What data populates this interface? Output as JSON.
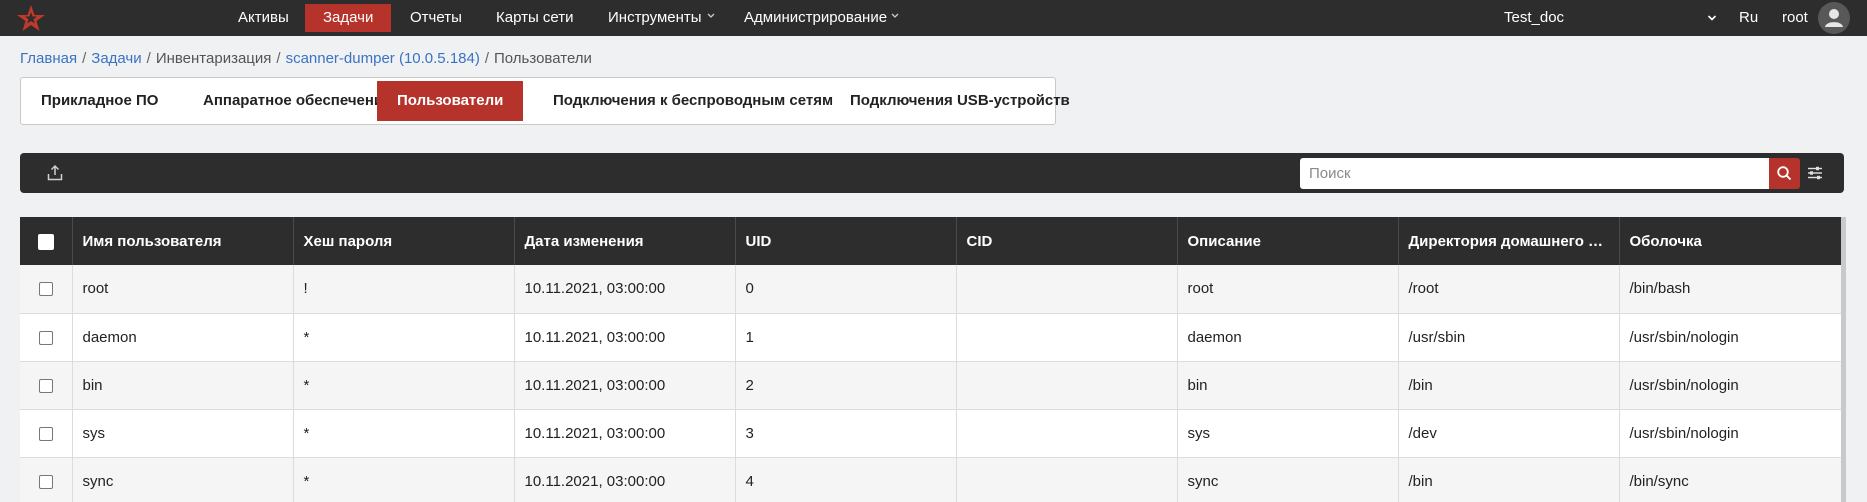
{
  "topbar": {
    "nav": [
      {
        "label": "Активы"
      },
      {
        "label": "Задачи",
        "active": true
      },
      {
        "label": "Отчеты"
      },
      {
        "label": "Карты сети"
      },
      {
        "label": "Инструменты",
        "dropdown": true
      },
      {
        "label": "Администрирование",
        "dropdown": true
      }
    ],
    "workspace": "Test_doc",
    "language": "Ru",
    "user": "root"
  },
  "breadcrumb": [
    {
      "label": "Главная",
      "link": true
    },
    {
      "label": "Задачи",
      "link": true
    },
    {
      "label": "Инвентаризация",
      "link": false
    },
    {
      "label": "scanner-dumper (10.0.5.184)",
      "link": true
    },
    {
      "label": "Пользователи",
      "link": false
    }
  ],
  "tabs": [
    {
      "label": "Прикладное ПО"
    },
    {
      "label": "Аппаратное обеспечение"
    },
    {
      "label": "Пользователи",
      "active": true
    },
    {
      "label": "Подключения к беспроводным сетям"
    },
    {
      "label": "Подключения USB-устройств"
    }
  ],
  "toolbar": {
    "search_placeholder": "Поиск",
    "export_icon": "upload-icon",
    "search_icon": "search-icon",
    "settings_icon": "sliders-icon"
  },
  "table": {
    "columns": [
      "Имя пользователя",
      "Хеш пароля",
      "Дата изменения",
      "UID",
      "CID",
      "Описание",
      "Директория домашнего каталога",
      "Оболочка"
    ],
    "rows": [
      [
        "root",
        "!",
        "10.11.2021, 03:00:00",
        "0",
        "",
        "root",
        "/root",
        "/bin/bash"
      ],
      [
        "daemon",
        "*",
        "10.11.2021, 03:00:00",
        "1",
        "",
        "daemon",
        "/usr/sbin",
        "/usr/sbin/nologin"
      ],
      [
        "bin",
        "*",
        "10.11.2021, 03:00:00",
        "2",
        "",
        "bin",
        "/bin",
        "/usr/sbin/nologin"
      ],
      [
        "sys",
        "*",
        "10.11.2021, 03:00:00",
        "3",
        "",
        "sys",
        "/dev",
        "/usr/sbin/nologin"
      ],
      [
        "sync",
        "*",
        "10.11.2021, 03:00:00",
        "4",
        "",
        "sync",
        "/bin",
        "/bin/sync"
      ]
    ]
  },
  "colors": {
    "accent": "#b5332a",
    "bar": "#2d2d2d",
    "link": "#3b73c4",
    "background": "#f0f1f2"
  }
}
